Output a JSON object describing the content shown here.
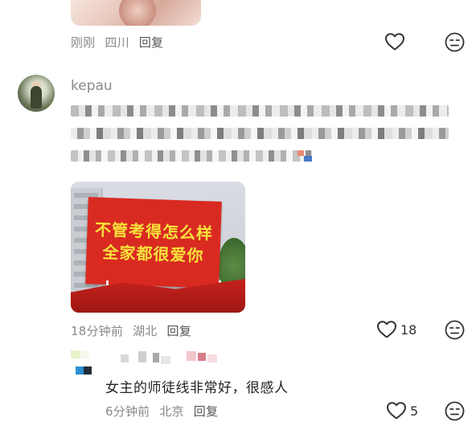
{
  "comment_top": {
    "time": "刚刚",
    "location": "四川",
    "reply_label": "回复"
  },
  "comment_main": {
    "username": "kepau",
    "time": "18分钟前",
    "location": "湖北",
    "reply_label": "回复",
    "like_count": "18",
    "image_banner": {
      "line1": "不管考得怎么样",
      "line2": "全家都很爱你"
    }
  },
  "reply": {
    "text": "女主的师徒线非常好，很感人",
    "time": "6分钟前",
    "location": "北京",
    "reply_label": "回复",
    "like_count": "5"
  },
  "icons": {
    "like": "heart-outline-icon",
    "dislike": "neutral-face-icon"
  }
}
